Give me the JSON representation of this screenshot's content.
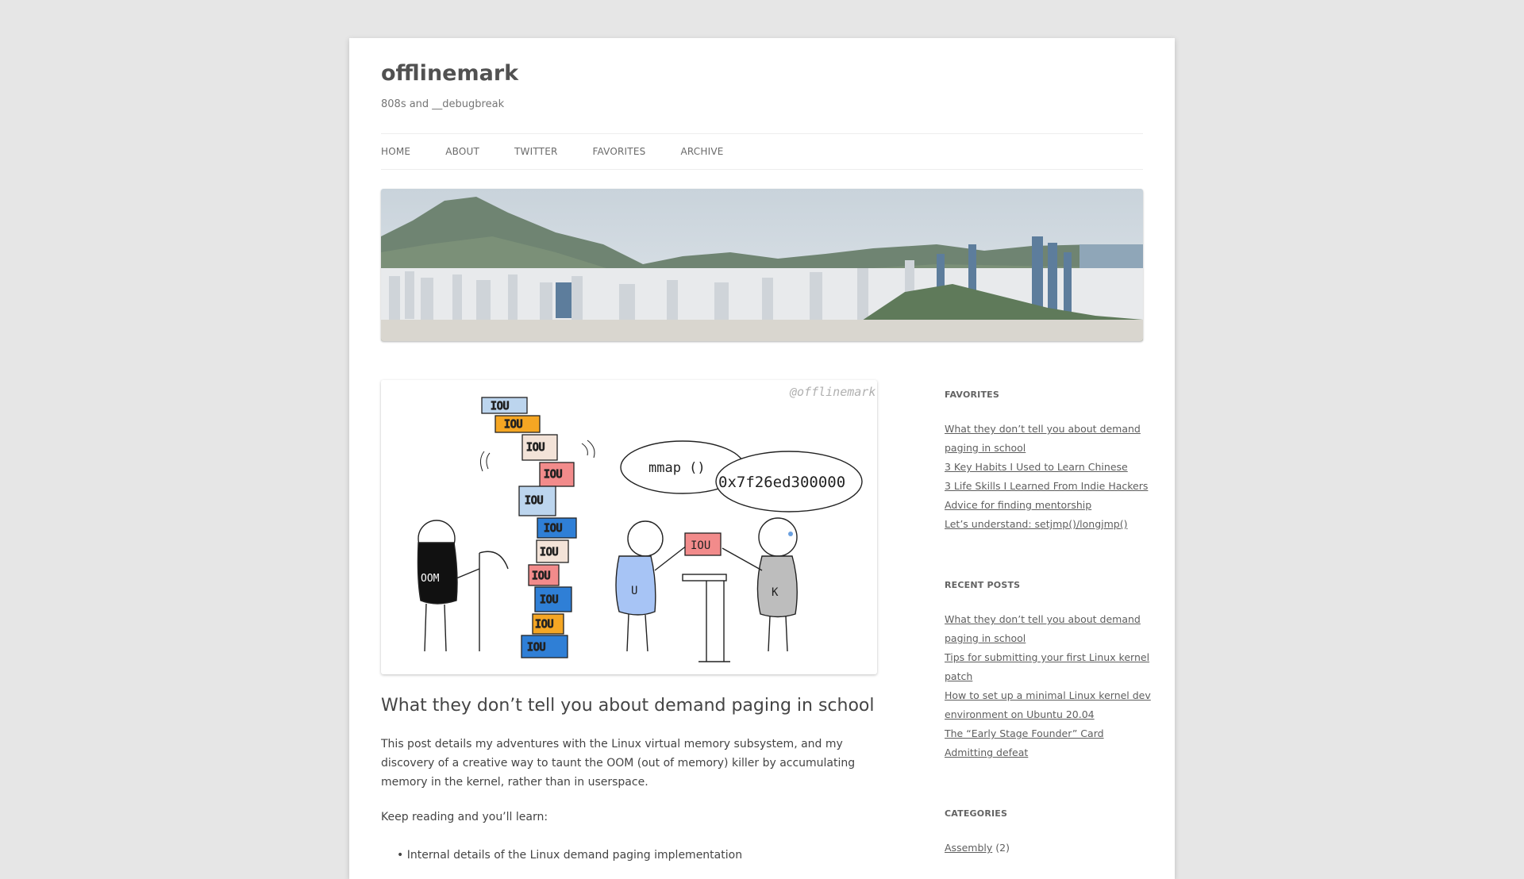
{
  "site": {
    "title": "offlinemark",
    "tagline": "808s and __debugbreak"
  },
  "nav": [
    {
      "label": "HOME"
    },
    {
      "label": "ABOUT"
    },
    {
      "label": "TWITTER"
    },
    {
      "label": "FAVORITES"
    },
    {
      "label": "ARCHIVE"
    }
  ],
  "feature_image": {
    "watermark": "@offlinemark",
    "blocks": [
      "IOU",
      "IOU",
      "IOU",
      "IOU",
      "IOU",
      "IOU",
      "IOU",
      "IOU",
      "IOU",
      "IOU",
      "IOU"
    ],
    "oom_label": "OOM",
    "mmap_text": "mmap ()",
    "address_text": "0x7f26ed300000",
    "handoff_block": "IOU",
    "user_label": "U",
    "kernel_label": "K"
  },
  "post": {
    "title": "What they don’t tell you about demand paging in school",
    "excerpt": "This post details my adventures with the Linux virtual memory subsystem, and my discovery of a creative way to taunt the OOM (out of memory) killer by accumulating memory in the kernel, rather than in userspace.",
    "keep_reading": "Keep reading and you’ll learn:",
    "bullet_1": "Internal details of the Linux demand paging implementation"
  },
  "sidebar": {
    "favorites_title": "FAVORITES",
    "favorites": [
      "What they don’t tell you about demand paging in school",
      "3 Key Habits I Used to Learn Chinese",
      "3 Life Skills I Learned From Indie Hackers",
      "Advice for finding mentorship",
      "Let’s understand: setjmp()/longjmp()"
    ],
    "recent_title": "RECENT POSTS",
    "recent": [
      "What they don’t tell you about demand paging in school",
      "Tips for submitting your first Linux kernel patch",
      "How to set up a minimal Linux kernel dev environment on Ubuntu 20.04",
      "The “Early Stage Founder” Card",
      "Admitting defeat"
    ],
    "categories_title": "CATEGORIES",
    "categories": [
      {
        "name": "Assembly",
        "count": "(2)"
      }
    ]
  },
  "colors": {
    "background": "#e6e6e6",
    "link": "#5e5e5e",
    "text": "#444444"
  }
}
